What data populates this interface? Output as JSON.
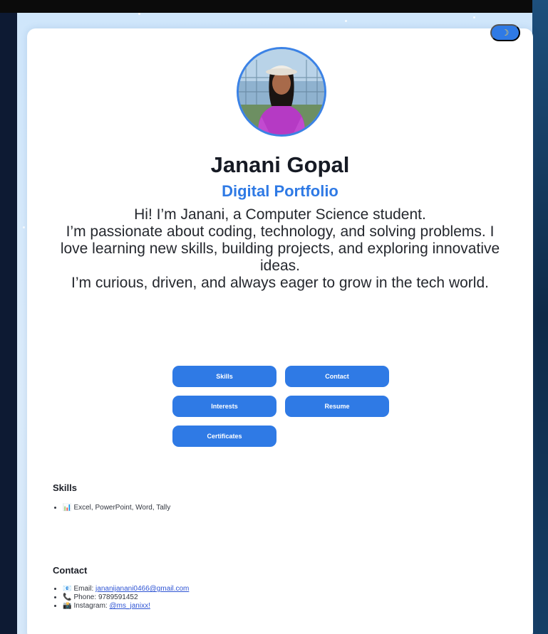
{
  "theme_toggle": {
    "icon": "moon-icon",
    "glyph": "☽"
  },
  "profile": {
    "name": "Janani Gopal",
    "subtitle": "Digital Portfolio",
    "bio": [
      "Hi! I’m Janani, a Computer Science student.",
      "I’m passionate about coding, technology, and solving problems. I love learning new skills, building projects, and exploring innovative ideas.",
      "I’m curious, driven, and always eager to grow in the tech world."
    ]
  },
  "nav_buttons": {
    "skills": "Skills",
    "contact": "Contact",
    "interests": "Interests",
    "resume": "Resume",
    "certificates": "Certificates"
  },
  "skills": {
    "title": "Skills",
    "items": [
      {
        "icon": "📊",
        "text": "Excel, PowerPoint, Word, Tally"
      }
    ]
  },
  "contact": {
    "title": "Contact",
    "email": {
      "icon": "📧",
      "label": "Email:",
      "value": "jananijanani0466@gmail.com"
    },
    "phone": {
      "icon": "📞",
      "label": "Phone:",
      "value": "9789591452"
    },
    "instagram": {
      "icon": "📸",
      "label": "Instagram:",
      "value": "@ms_janixx!"
    }
  },
  "colors": {
    "accent": "#2f7ae5",
    "backdrop": "#cfe6fb",
    "text": "#161a24"
  }
}
